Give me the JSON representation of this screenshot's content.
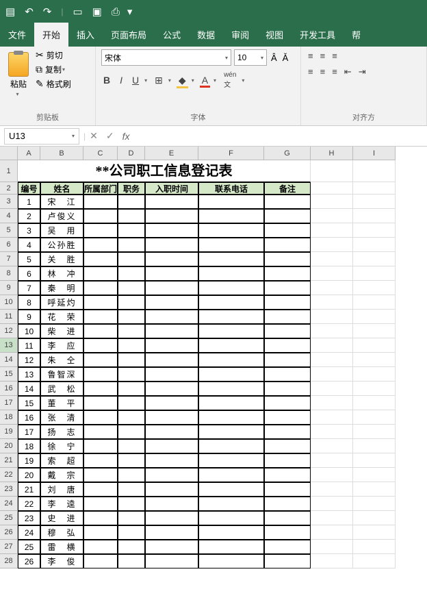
{
  "titlebar": {
    "save_icon": "💾"
  },
  "menu": {
    "items": [
      "文件",
      "开始",
      "插入",
      "页面布局",
      "公式",
      "数据",
      "审阅",
      "视图",
      "开发工具",
      "帮"
    ]
  },
  "ribbon": {
    "clipboard": {
      "paste": "粘贴",
      "cut": "剪切",
      "copy": "复制",
      "format_painter": "格式刷",
      "group_label": "剪贴板"
    },
    "font": {
      "name": "宋体",
      "size": "10",
      "bold": "B",
      "italic": "I",
      "underline": "U",
      "group_label": "字体"
    },
    "align": {
      "group_label": "对齐方"
    }
  },
  "namebox": {
    "cell_ref": "U13",
    "fx": "fx"
  },
  "columns": [
    {
      "letter": "A",
      "w": 33
    },
    {
      "letter": "B",
      "w": 63
    },
    {
      "letter": "C",
      "w": 50
    },
    {
      "letter": "D",
      "w": 40
    },
    {
      "letter": "E",
      "w": 78
    },
    {
      "letter": "F",
      "w": 96
    },
    {
      "letter": "G",
      "w": 68
    },
    {
      "letter": "H",
      "w": 62
    },
    {
      "letter": "I",
      "w": 62
    }
  ],
  "title_text": "**公司职工信息登记表",
  "headers": [
    "编号",
    "姓名",
    "所属部门",
    "职务",
    "入职时间",
    "联系电话",
    "备注"
  ],
  "rows": [
    {
      "n": "1",
      "name": "宋　江"
    },
    {
      "n": "2",
      "name": "卢俊义"
    },
    {
      "n": "3",
      "name": "吴　用"
    },
    {
      "n": "4",
      "name": "公孙胜"
    },
    {
      "n": "5",
      "name": "关　胜"
    },
    {
      "n": "6",
      "name": "林　冲"
    },
    {
      "n": "7",
      "name": "秦　明"
    },
    {
      "n": "8",
      "name": "呼延灼"
    },
    {
      "n": "9",
      "name": "花　荣"
    },
    {
      "n": "10",
      "name": "柴　进"
    },
    {
      "n": "11",
      "name": "李　应"
    },
    {
      "n": "12",
      "name": "朱　仝"
    },
    {
      "n": "13",
      "name": "鲁智深"
    },
    {
      "n": "14",
      "name": "武　松"
    },
    {
      "n": "15",
      "name": "董　平"
    },
    {
      "n": "16",
      "name": "张　清"
    },
    {
      "n": "17",
      "name": "扬　志"
    },
    {
      "n": "18",
      "name": "徐　宁"
    },
    {
      "n": "19",
      "name": "索　超"
    },
    {
      "n": "20",
      "name": "戴　宗"
    },
    {
      "n": "21",
      "name": "刘　唐"
    },
    {
      "n": "22",
      "name": "李　逵"
    },
    {
      "n": "23",
      "name": "史　进"
    },
    {
      "n": "24",
      "name": "穆　弘"
    },
    {
      "n": "25",
      "name": "雷　横"
    },
    {
      "n": "26",
      "name": "李　俊"
    }
  ],
  "selected_row": 13
}
